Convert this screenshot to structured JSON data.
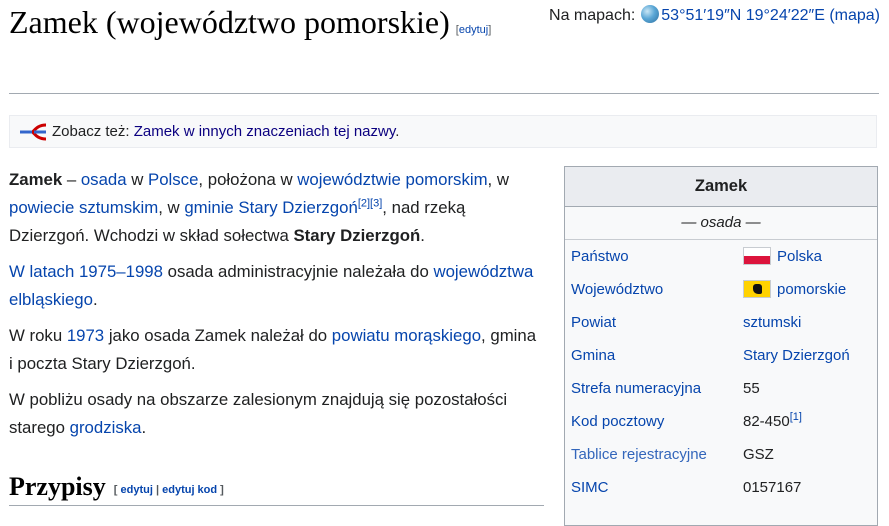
{
  "title": {
    "text": "Zamek (województwo pomorskie)",
    "edit": "[edytuj]"
  },
  "coords": {
    "label": "Na mapach:",
    "value": "53°51′19″N 19°24′22″E",
    "map_link": "(mapa)"
  },
  "hatnote": {
    "prefix": "Zobacz też:",
    "link": "Zamek w innych znaczeniach tej nazwy",
    "suffix": "."
  },
  "paragraphs": {
    "p1": {
      "bold": "Zamek",
      "t1": " – ",
      "l1": "osada",
      "t2": " w ",
      "l2": "Polsce",
      "t3": ", położona w ",
      "l3": "województwie pomorskim",
      "t4": ", w ",
      "l4": "powiecie sztumskim",
      "t5": ", w ",
      "l5": "gminie Stary Dzierzgoń",
      "ref1": "[2]",
      "ref2": "[3]",
      "t6": ", nad rzeką Dzierzgoń. Wchodzi w skład sołectwa ",
      "bold2": "Stary Dzierzgoń",
      "t7": "."
    },
    "p2": {
      "l1": "W latach 1975–1998",
      "t1": " osada administracyjnie należała do ",
      "l2": "województwa elbląskiego",
      "t2": "."
    },
    "p3": {
      "t1": "W roku ",
      "l1": "1973",
      "t2": " jako osada Zamek należał do ",
      "l2": "powiatu morąskiego",
      "t3": ", gmina i poczta Stary Dzierzgoń."
    },
    "p4": {
      "t1": "W pobliżu osady na obszarze zalesionym znajdują się pozostałości starego ",
      "l1": "grodziska",
      "t2": "."
    }
  },
  "section": {
    "heading": "Przypisy",
    "edit_open": "[ ",
    "edit1": "edytuj",
    "sep": " | ",
    "edit2": "edytuj kod",
    "edit_close": " ]"
  },
  "infobox": {
    "title": "Zamek",
    "type": "—  osada  —",
    "rows": [
      {
        "label": "Państwo",
        "value": "Polska",
        "flag": "poland-flag"
      },
      {
        "label": "Województwo",
        "value": "pomorskie",
        "flag": "pomorskie-flag"
      },
      {
        "label": "Powiat",
        "value": "sztumski"
      },
      {
        "label": "Gmina",
        "value": "Stary Dzierzgoń"
      },
      {
        "label": "Strefa numeracyjna",
        "value": "55"
      },
      {
        "label": "Kod pocztowy",
        "value": "82-450",
        "ref": "[1]"
      },
      {
        "label": "Tablice rejestracyjne",
        "value": "GSZ"
      },
      {
        "label": "SIMC",
        "value": "0157167"
      }
    ]
  }
}
